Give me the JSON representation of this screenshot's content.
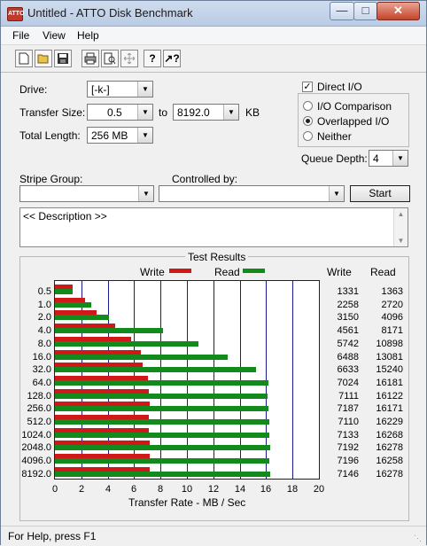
{
  "window": {
    "title": "Untitled - ATTO Disk Benchmark",
    "app_icon_text": "ATTO"
  },
  "menu": [
    "File",
    "View",
    "Help"
  ],
  "toolbar": {
    "buttons": [
      "new-icon",
      "open-icon",
      "save-icon",
      "print-icon",
      "print-preview-icon",
      "move-icon",
      "help-icon",
      "context-help-icon"
    ]
  },
  "form": {
    "drive_label": "Drive:",
    "drive_value": "[-k-]",
    "transfer_size_label": "Transfer Size:",
    "transfer_from": "0.5",
    "to_label": "to",
    "transfer_to": "8192.0",
    "kb_label": "KB",
    "total_length_label": "Total Length:",
    "total_length_value": "256 MB",
    "direct_io_label": "Direct I/O",
    "direct_io_checked": true,
    "io_comparison_label": "I/O Comparison",
    "overlapped_io_label": "Overlapped I/O",
    "neither_label": "Neither",
    "selected_mode": "Overlapped I/O",
    "queue_depth_label": "Queue Depth:",
    "queue_depth_value": "4",
    "stripe_group_label": "Stripe Group:",
    "stripe_group_value": "",
    "controlled_by_label": "Controlled by:",
    "controlled_by_value": "",
    "start_label": "Start",
    "description": "<< Description >>"
  },
  "results": {
    "title": "Test Results",
    "write_legend": "Write",
    "read_legend": "Read",
    "write_header": "Write",
    "read_header": "Read",
    "xlabel": "Transfer Rate - MB / Sec"
  },
  "chart_data": {
    "type": "bar",
    "orientation": "horizontal",
    "categories": [
      "0.5",
      "1.0",
      "2.0",
      "4.0",
      "8.0",
      "16.0",
      "32.0",
      "64.0",
      "128.0",
      "256.0",
      "512.0",
      "1024.0",
      "2048.0",
      "4096.0",
      "8192.0"
    ],
    "series": [
      {
        "name": "Write",
        "color": "#d01818",
        "values": [
          1.33,
          2.26,
          3.15,
          4.56,
          5.74,
          6.49,
          6.63,
          7.02,
          7.11,
          7.19,
          7.11,
          7.13,
          7.19,
          7.2,
          7.15
        ]
      },
      {
        "name": "Read",
        "color": "#138a1c",
        "values": [
          1.36,
          2.72,
          4.1,
          8.17,
          10.9,
          13.08,
          15.24,
          16.18,
          16.12,
          16.17,
          16.23,
          16.27,
          16.28,
          16.26,
          16.28
        ]
      }
    ],
    "write_numbers": [
      "1331",
      "2258",
      "3150",
      "4561",
      "5742",
      "6488",
      "6633",
      "7024",
      "7111",
      "7187",
      "7110",
      "7133",
      "7192",
      "7196",
      "7146"
    ],
    "read_numbers": [
      "1363",
      "2720",
      "4096",
      "8171",
      "10898",
      "13081",
      "15240",
      "16181",
      "16122",
      "16171",
      "16229",
      "16268",
      "16278",
      "16258",
      "16278"
    ],
    "x_ticks": [
      "0",
      "2",
      "4",
      "6",
      "8",
      "10",
      "12",
      "14",
      "16",
      "18",
      "20"
    ],
    "xlim": [
      0,
      20
    ],
    "xlabel": "Transfer Rate - MB / Sec",
    "grid": true,
    "legend": "top"
  },
  "status": {
    "text": "For Help, press F1"
  }
}
